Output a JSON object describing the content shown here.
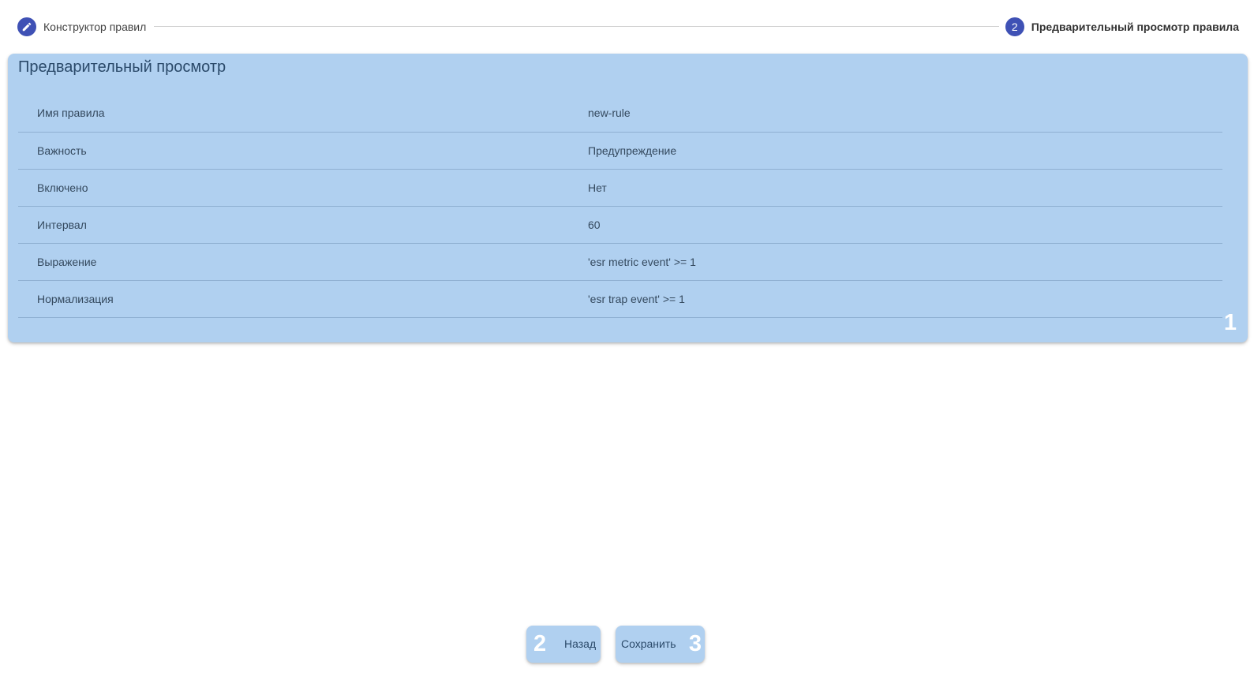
{
  "stepper": {
    "steps": [
      {
        "label": "Конструктор правил",
        "icon": "pencil-icon",
        "state": "completed"
      },
      {
        "label": "Предварительный просмотр правила",
        "number": "2",
        "state": "active"
      }
    ],
    "accent_color": "#3f51b5"
  },
  "preview": {
    "title": "Предварительный просмотр",
    "rows": [
      {
        "key": "Имя правила",
        "value": "new-rule"
      },
      {
        "key": "Важность",
        "value": "Предупреждение"
      },
      {
        "key": "Включено",
        "value": "Нет"
      },
      {
        "key": "Интервал",
        "value": "60"
      },
      {
        "key": "Выражение",
        "value": "'esr metric event' >= 1"
      },
      {
        "key": "Нормализация",
        "value": "'esr trap event' >= 1"
      }
    ],
    "badge": "1",
    "background_color": "#b0d0f0"
  },
  "actions": {
    "back_label": "Назад",
    "back_badge": "2",
    "save_label": "Сохранить",
    "save_badge": "3"
  }
}
